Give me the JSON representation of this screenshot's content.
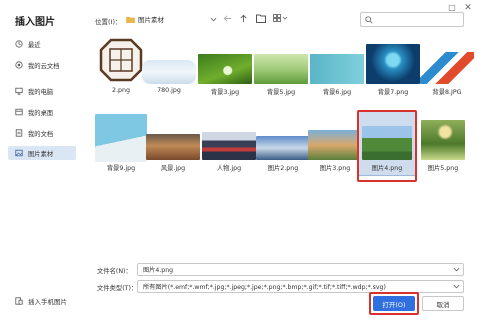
{
  "window": {
    "maximize_icon": "□",
    "close_icon": "✕"
  },
  "sidebar": {
    "title": "插入图片",
    "items": [
      {
        "label": "最近",
        "icon": "clock-icon"
      },
      {
        "label": "我的云文档",
        "icon": "cloud-doc-icon"
      },
      {
        "label": "我的电脑",
        "icon": "monitor-icon"
      },
      {
        "label": "我的桌面",
        "icon": "desktop-icon"
      },
      {
        "label": "我的文档",
        "icon": "document-icon"
      },
      {
        "label": "图片素材",
        "icon": "image-folder-icon",
        "active": true
      }
    ],
    "bottom_label": "插入手机图片"
  },
  "toolbar": {
    "location_label": "位置(I)：",
    "location_value": "图片素材",
    "search_placeholder": ""
  },
  "files": [
    {
      "name": "2.png"
    },
    {
      "name": "780.jpg"
    },
    {
      "name": "背景3.jpg"
    },
    {
      "name": "背景5.jpg"
    },
    {
      "name": "背景6.jpg"
    },
    {
      "name": "背景7.png"
    },
    {
      "name": "背景8.JPG"
    },
    {
      "name": "背景9.jpg"
    },
    {
      "name": "风景.jpg"
    },
    {
      "name": "人物.jpg"
    },
    {
      "name": "图片2.png"
    },
    {
      "name": "图片3.png"
    },
    {
      "name": "图片4.png",
      "selected": true
    },
    {
      "name": "图片5.png"
    }
  ],
  "form": {
    "filename_label": "文件名(N)：",
    "filename_value": "图片4.png",
    "filetype_label": "文件类型(T)：",
    "filetype_value": "所有图片(*.emf;*.wmf;*.jpg;*.jpeg;*.jpe;*.png;*.bmp;*.gif;*.tif;*.tiff;*.wdp;*.svg)"
  },
  "buttons": {
    "open": "打开(O)",
    "cancel": "取消"
  },
  "colors": {
    "accent": "#2f6fe0",
    "highlight": "#d9312b",
    "selected_bg": "#cfdcee"
  }
}
